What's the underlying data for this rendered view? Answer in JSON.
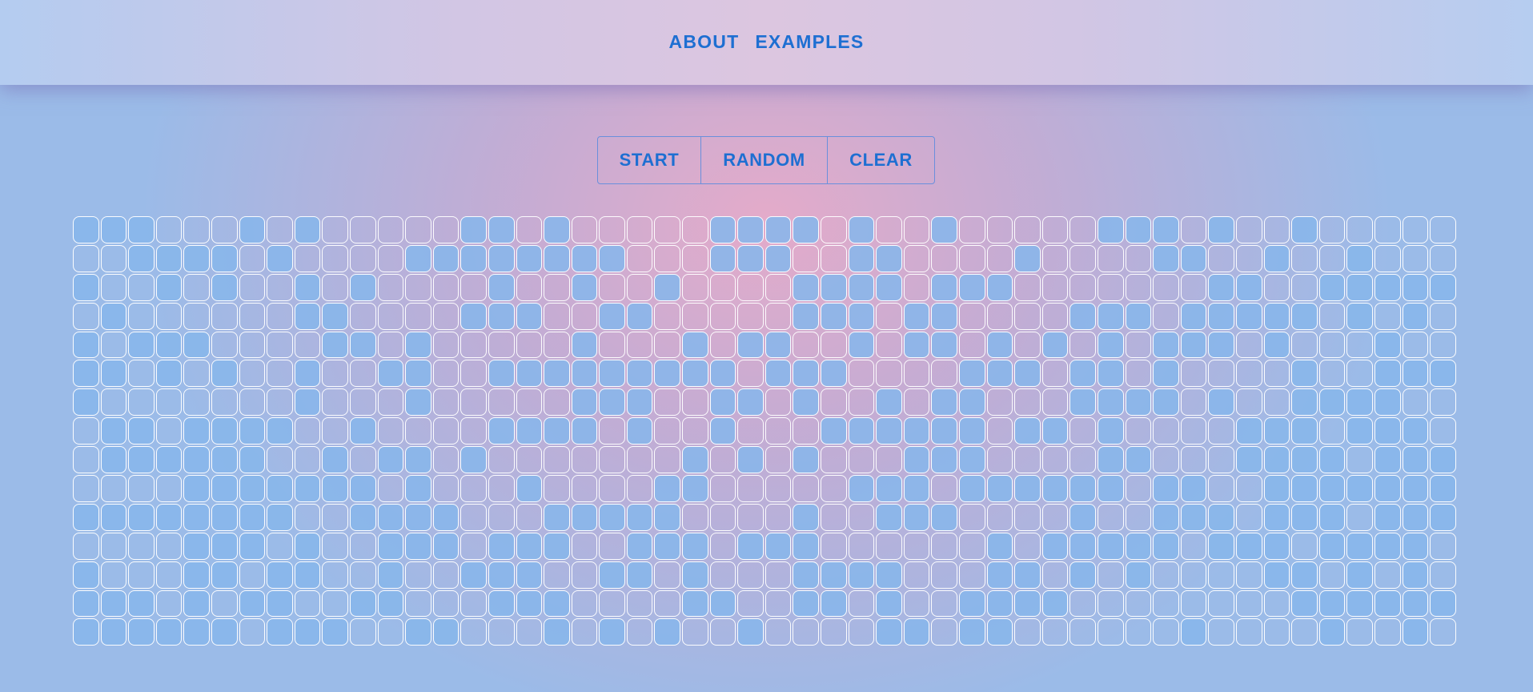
{
  "nav": {
    "items": [
      {
        "label": "ABOUT"
      },
      {
        "label": "EXAMPLES"
      }
    ]
  },
  "controls": {
    "start_label": "START",
    "random_label": "RANDOM",
    "clear_label": "CLEAR"
  },
  "colors": {
    "accent": "#1e6fd2",
    "alive_cell": "#87b6eb",
    "dead_cell_border": "#ffffff"
  },
  "grid": {
    "cols": 50,
    "rows": 15,
    "cells": [
      "11100010100000110100000111101001000001110100100000",
      "00111101000011111111000111001100001000011001001000",
      "10010100101000010010010000111101110000000110011111",
      "01000000110000111001100000111011000011101111101010",
      "10111000011010000010001011001011010101011101000100",
      "11010100100110011111111101110000111011010000100111",
      "10000000100010000011100110100101100011110100111100",
      "01101111001000011110100100011111101101000011101110",
      "01111110010110100000001010100011100001100011110111",
      "00001111111010001000011000001110111111011001111111",
      "11111111001111000111110000100111000010011101110111",
      "00001110100111011100111011100000010111110111011110",
      "10001101100100111001101000111100011010100001101010",
      "11101011001100011100001100110100111100000000111111",
      "11111101110011000101010010000110110000001000010010"
    ]
  }
}
